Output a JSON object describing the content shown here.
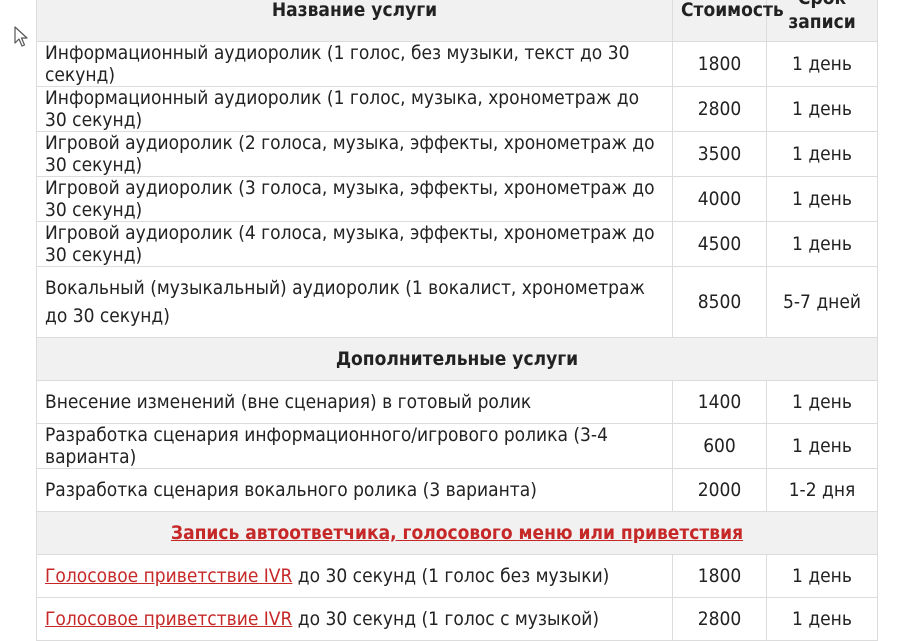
{
  "header": {
    "name_col": "Название услуги",
    "cost_col": "Стоимость",
    "term_col_top": "Срок",
    "term_col_bottom": "записи"
  },
  "rows": [
    {
      "name": "Информационный аудиоролик (1 голос, без музыки, текст до 30 секунд)",
      "cost": "1800",
      "term": "1 день"
    },
    {
      "name": "Информационный аудиоролик (1 голос, музыка, хронометраж до 30 секунд)",
      "cost": "2800",
      "term": "1 день"
    },
    {
      "name": "Игровой аудиоролик (2 голоса, музыка, эффекты, хронометраж до 30 секунд)",
      "cost": "3500",
      "term": "1 день"
    },
    {
      "name": "Игровой аудиоролик (3 голоса, музыка, эффекты, хронометраж до 30 секунд)",
      "cost": "4000",
      "term": "1 день"
    },
    {
      "name": "Игровой аудиоролик (4 голоса, музыка, эффекты, хронометраж до 30 секунд)",
      "cost": "4500",
      "term": "1 день"
    },
    {
      "name": "Вокальный (музыкальный) аудиоролик (1 вокалист, хронометраж до 30 секунд)",
      "cost": "8500",
      "term": "5-7 дней"
    }
  ],
  "section_additional": "Дополнительные услуги",
  "additional_rows": [
    {
      "name": "Внесение изменений (вне сценария) в готовый ролик",
      "cost": "1400",
      "term": "1 день"
    },
    {
      "name": "Разработка сценария информационного/игрового ролика (3-4 варианта)",
      "cost": "600",
      "term": "1 день"
    },
    {
      "name": "Разработка сценария вокального ролика (3 варианта)",
      "cost": "2000",
      "term": "1-2 дня"
    }
  ],
  "section_ivr": "Запись автоответчика, голосового меню или приветствия",
  "ivr_rows": [
    {
      "link": "Голосовое приветствие IVR",
      "rest": " до 30 секунд (1 голос без музыки)",
      "cost": "1800",
      "term": "1 день"
    },
    {
      "link": "Голосовое приветствие IVR",
      "rest": " до 30 секунд (1 голос с музыкой)",
      "cost": "2800",
      "term": "1 день"
    }
  ],
  "colors": {
    "accent_link": "#c62828",
    "header_bg": "#f1f1f1",
    "border": "#dcdcdc"
  },
  "icons": {
    "cursor": "mouse-pointer-icon"
  }
}
